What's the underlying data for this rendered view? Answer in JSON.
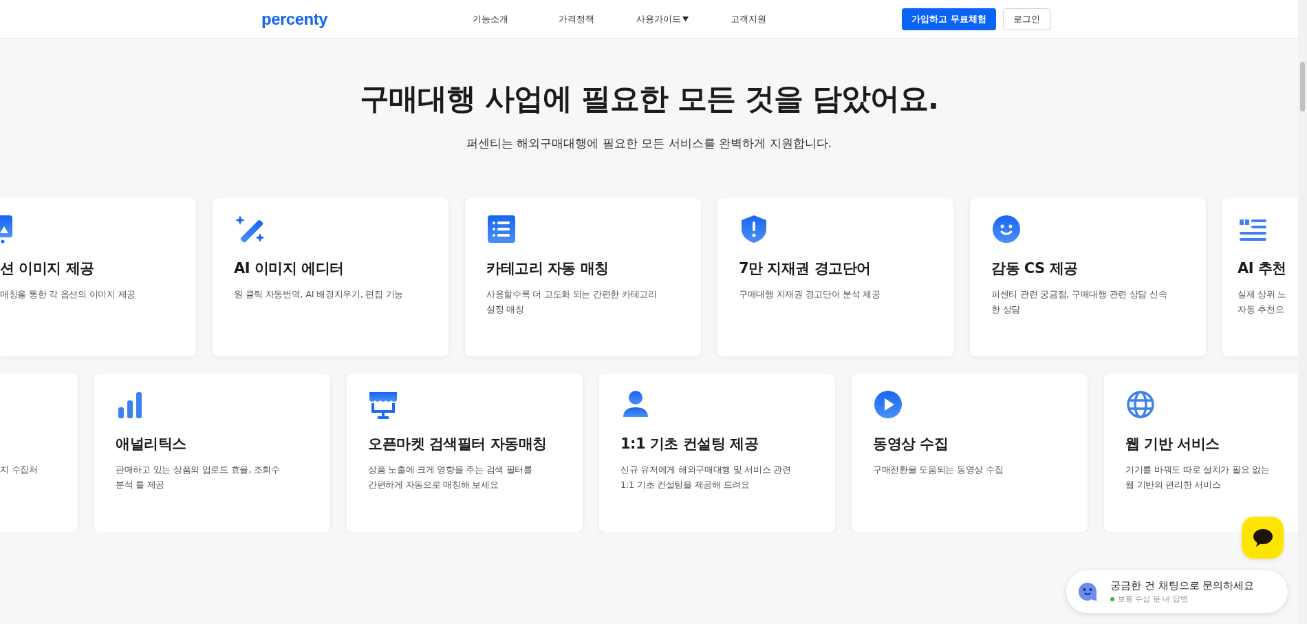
{
  "header": {
    "logo": "percenty",
    "nav": [
      {
        "label": "기능소개",
        "has_menu": false
      },
      {
        "label": "가격정책",
        "has_menu": false
      },
      {
        "label": "사용가이드",
        "has_menu": true
      },
      {
        "label": "고객지원",
        "has_menu": false
      }
    ],
    "buttons": [
      {
        "label": "가입하고 무료체험",
        "kind": "primary"
      },
      {
        "label": "로그인",
        "kind": "outline"
      }
    ]
  },
  "hero": {
    "title": "구매대행 사업에 필요한 모든 것을 담았어요.",
    "subtitle": "퍼센티는 해외구매대행에 필요한 모든 서비스를 완벽하게 지원합니다."
  },
  "feature_rows": [
    {
      "cards": [
        {
          "title": "션 이미지 제공",
          "description": [
            "매칭을 통한 각 옵션의 이미지 제공"
          ]
        },
        {
          "title": "AI 이미지 에디터",
          "description": [
            "원 클릭 자동번역, AI 배경지우기, 편집 기능"
          ]
        },
        {
          "title": "카테고리 자동 매칭",
          "description": [
            "사용할수록 더 고도화 되는 간편한 카테고리",
            "설정 매칭"
          ]
        },
        {
          "title": "7만 지재권 경고단어",
          "description": [
            "구매대행 지재권 경고단어 분석 제공"
          ]
        },
        {
          "title": "감동 CS 제공",
          "description": [
            "퍼센티 관련 궁금점, 구매대행 관련 상담 신속",
            "한 상담"
          ]
        },
        {
          "title": "AI 추천",
          "description": [
            "실제 상위 노",
            "자동 추천으"
          ]
        }
      ]
    },
    {
      "cards": [
        {
          "description": [
            "지 수집처"
          ]
        },
        {
          "title": "애널리틱스",
          "description": [
            "판매하고 있는 상품의 업로드 효율, 조회수",
            "분석 툴 제공"
          ]
        },
        {
          "title": "오픈마켓 검색필터 자동매칭",
          "description": [
            "상품 노출에 크게 영향을 주는 검색 필터를",
            "간편하게 자동으로 매칭해 보세요"
          ]
        },
        {
          "title": "1:1 기초 컨설팅 제공",
          "description": [
            "신규 유저에게 해외구매대행 및 서비스 관련",
            "1:1 기초 컨설팅을 제공해 드려요"
          ]
        },
        {
          "title": "동영상 수집",
          "description": [
            "구매전환율 도움되는 동영상 수집"
          ]
        },
        {
          "title": "웹 기반 서비스",
          "description": [
            "기기를 바꿔도 따로 설치가 필요 없는",
            "웹 기반의 편리한 서비스"
          ]
        }
      ]
    }
  ],
  "chat": {
    "prompt": "궁금한 건 채팅으로 문의하세요",
    "status": "보통 수십 분 내 답변",
    "online": true
  }
}
